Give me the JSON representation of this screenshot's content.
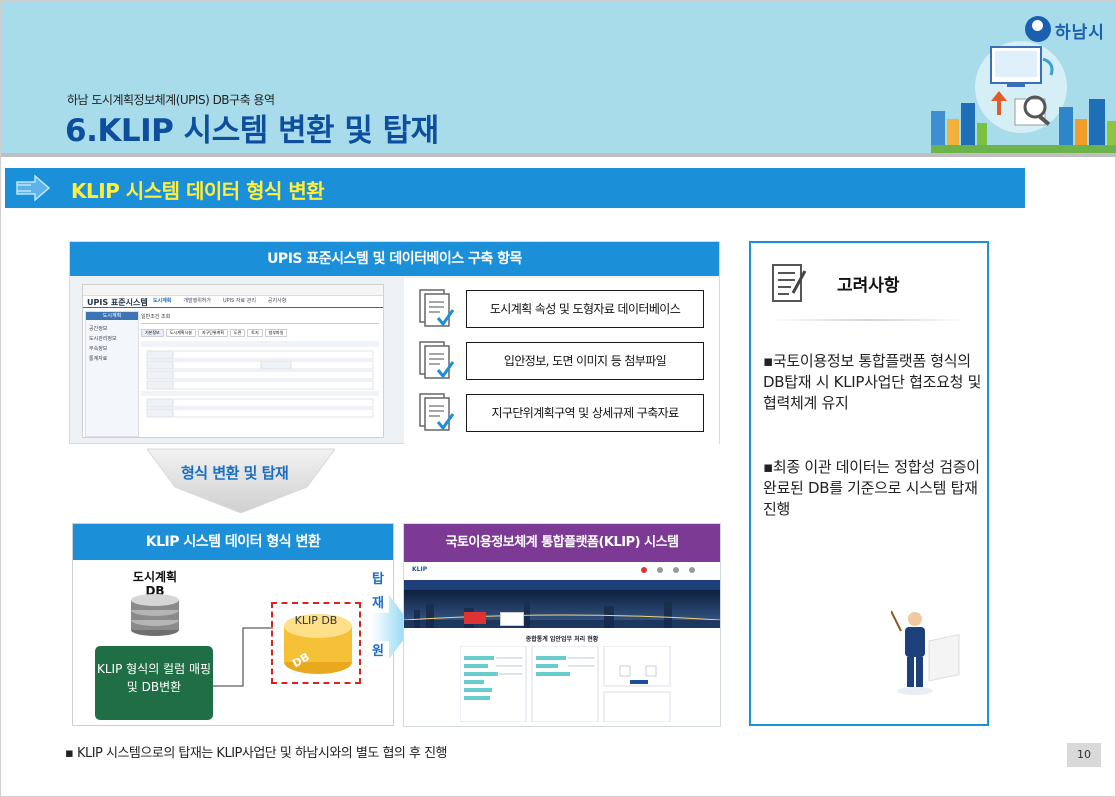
{
  "header": {
    "subtitle": "하남 도시계획정보체계(UPIS) DB구축 용역",
    "title": "6.KLIP 시스템 변환 및 탑재",
    "logo_text": "하남시"
  },
  "section": {
    "title": "KLIP 시스템 데이터 형식 변환"
  },
  "upis": {
    "header": "UPIS 표준시스템 및 데이터베이스 구축 항목",
    "screenshot": {
      "app_title": "UPIS 표준시스템",
      "nav": [
        "도시계획",
        "개발행위허가",
        "UPIS 자료 관리",
        "공지사항"
      ],
      "side_items": [
        "도시계획",
        "공간정보",
        "도시관리정보",
        "부속정보",
        "통계자료"
      ],
      "panel_title": "일반조건 조회",
      "tabs": [
        "기본정보",
        "도시계획시설",
        "지구단위계획",
        "도면",
        "토지",
        "첨부파일"
      ]
    },
    "items": [
      "도시계획 속성 및 도형자료 데이터베이스",
      "입안정보, 도면 이미지 등 첨부파일",
      "지구단위계획구역 및 상세규제 구축자료"
    ]
  },
  "flow": {
    "arrow_label": "형식 변환 및 탑재",
    "tap_label": "탑재 지원"
  },
  "klip_convert": {
    "header": "KLIP 시스템 데이터 형식 변환",
    "db_label": "도시계획 DB",
    "mapping_text": "KLIP 형식의 컬럼 매핑 및 DB변환",
    "klip_db_label": "KLIP DB"
  },
  "klip_system": {
    "header": "국토이용정보체계 통합플랫폼(KLIP) 시스템",
    "screenshot": {
      "brand": "KLIP",
      "panel_title": "종합통계 입안업무 처리 현황"
    }
  },
  "considerations": {
    "title": "고려사항",
    "bullets": [
      "▪국토이용정보 통합플랫폼 형식의 DB탑재 시 KLIP사업단 협조요청 및 협력체계 유지",
      "▪최종 이관 데이터는 정합성 검증이 완료된 DB를 기준으로 시스템 탑재 진행"
    ]
  },
  "footnote": "▪ KLIP 시스템으로의 탑재는 KLIP사업단 및 하남시와의 별도 협의 후 진행",
  "page_number": "10",
  "colors": {
    "banner": "#a8dcea",
    "accent_blue": "#1b8fd8",
    "title_blue": "#0d4e9e",
    "purple": "#7d3a94",
    "green": "#1f6e45",
    "section_title": "#ffef3a"
  }
}
